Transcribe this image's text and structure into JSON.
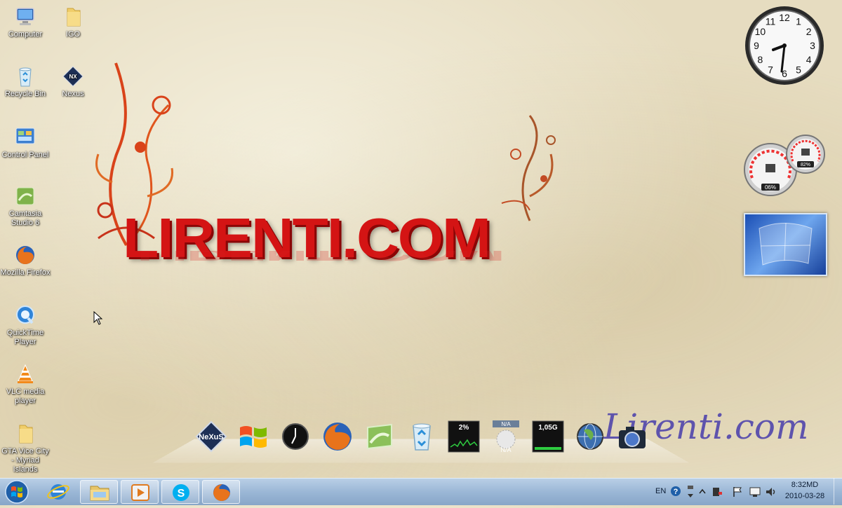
{
  "desktop_icons": [
    {
      "label": "Computer",
      "icon": "computer-icon"
    },
    {
      "label": "IGO",
      "icon": "folder-icon"
    },
    {
      "label": "Recycle Bin",
      "icon": "recycle-bin-icon"
    },
    {
      "label": "Nexus",
      "icon": "nexus-icon"
    },
    {
      "label": "Control Panel",
      "icon": "control-panel-icon"
    },
    {
      "label": "Camtasia Studio 6",
      "icon": "camtasia-icon"
    },
    {
      "label": "Mozilla Firefox",
      "icon": "firefox-icon"
    },
    {
      "label": "QuickTime Player",
      "icon": "quicktime-icon"
    },
    {
      "label": "VLC media player",
      "icon": "vlc-icon"
    },
    {
      "label": "GTA Vice City - Myriad Islands",
      "icon": "folder-icon"
    }
  ],
  "wallpaper": {
    "logo_text": "LIRENTI.COM",
    "signature_text": "Lirenti.com",
    "logo_color": "#d41414"
  },
  "gadgets": {
    "clock": {
      "numbers": [
        "12",
        "1",
        "2",
        "3",
        "4",
        "5",
        "6",
        "7",
        "8",
        "9",
        "10",
        "11"
      ]
    },
    "cpu_meter": {
      "cpu": "06%",
      "ram": "82%",
      "cpu_value": 0.06,
      "ram_value": 0.82
    },
    "slideshow": {
      "icon": "windows-slideshow-icon"
    }
  },
  "dock": {
    "items": [
      {
        "icon": "nexus-icon",
        "label": "NeXuS"
      },
      {
        "icon": "windows-flag-icon",
        "label": ""
      },
      {
        "icon": "clock-icon",
        "label": ""
      },
      {
        "icon": "firefox-icon",
        "label": ""
      },
      {
        "icon": "camtasia-icon",
        "label": ""
      },
      {
        "icon": "recycle-bin-icon",
        "label": ""
      },
      {
        "icon": "cpu-graph-icon",
        "label": "2%"
      },
      {
        "icon": "network-icon",
        "label": "N/A",
        "sublabel": "N/A"
      },
      {
        "icon": "memory-graph-icon",
        "label": "1,05G"
      },
      {
        "icon": "globe-icon",
        "label": ""
      },
      {
        "icon": "camera-icon",
        "label": ""
      }
    ]
  },
  "taskbar": {
    "buttons": [
      {
        "icon": "internet-explorer-icon"
      },
      {
        "icon": "windows-explorer-icon"
      },
      {
        "icon": "media-player-icon"
      },
      {
        "icon": "skype-icon"
      },
      {
        "icon": "firefox-icon"
      }
    ],
    "tray": {
      "language": "EN",
      "time": "8:32MD",
      "date": "2010-03-28"
    }
  },
  "colors": {
    "taskbar": "#9bb7d6",
    "wallpaper": "#e6dcc0",
    "logo": "#d41414",
    "signature": "#4a3ca8"
  }
}
